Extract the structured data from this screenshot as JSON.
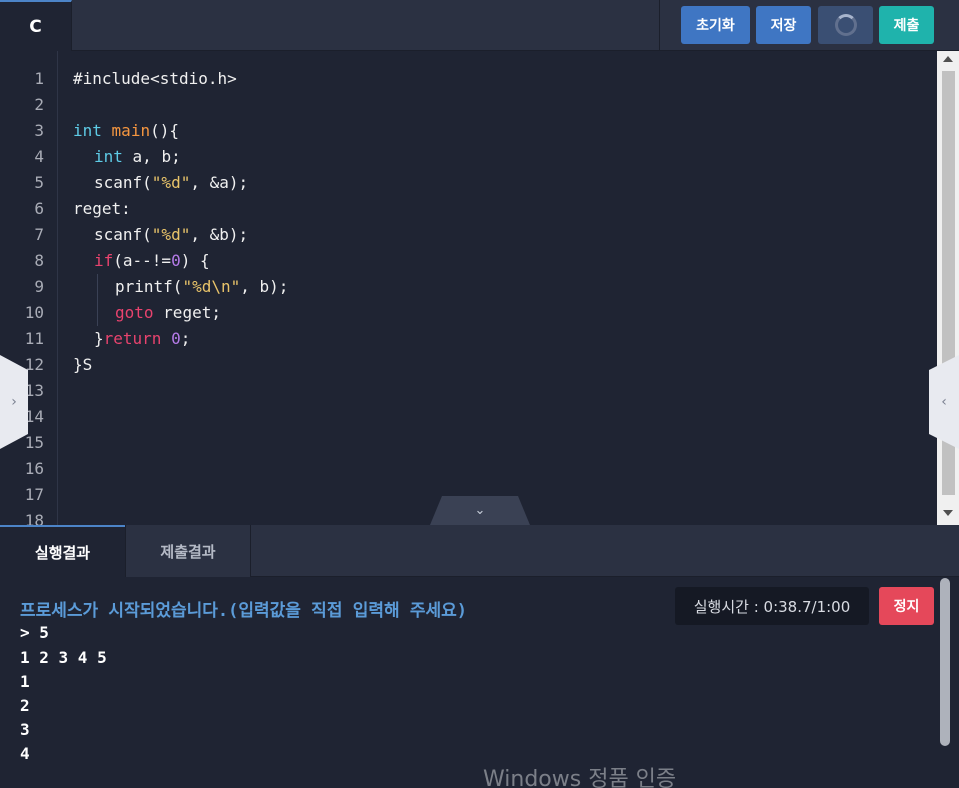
{
  "editor_header": {
    "language_tab": "C",
    "buttons": {
      "reset": "초기화",
      "save": "저장",
      "submit": "제출"
    }
  },
  "editor": {
    "line_numbers": [
      "1",
      "2",
      "3",
      "4",
      "5",
      "6",
      "7",
      "8",
      "9",
      "10",
      "11",
      "12",
      "13",
      "14",
      "15",
      "16",
      "17",
      "18"
    ],
    "code": {
      "l1": "#include<stdio.h>",
      "l3a": "int",
      "l3b": "main",
      "l3c": "(){",
      "l4a": "int",
      "l4b": "a, b;",
      "l5a": "scanf(",
      "l5b": "\"%d\"",
      "l5c": ", &a);",
      "l6": "reget:",
      "l7a": "scanf(",
      "l7b": "\"%d\"",
      "l7c": ", &b);",
      "l8a": "if",
      "l8b": "(a--!=",
      "l8c": "0",
      "l8d": ") {",
      "l9a": "printf(",
      "l9b": "\"%d\\n\"",
      "l9c": ", b);",
      "l10a": "goto",
      "l10b": "reget;",
      "l11a": "}",
      "l11b": "return",
      "l11c": "0",
      "l11d": ";",
      "l12": "}S"
    }
  },
  "result_tabs": {
    "run_result": "실행결과",
    "submit_result": "제출결과"
  },
  "console": {
    "message": "프로세스가 시작되었습니다.(입력값을 직접 입력해 주세요)",
    "lines": [
      "> 5",
      "1 2 3 4 5",
      "1",
      "2",
      "3",
      "4"
    ],
    "timer": "실행시간 : 0:38.7/1:00",
    "stop_label": "정지"
  },
  "watermark": "Windows 정품 인증",
  "colors": {
    "accent_blue": "#3f76c3",
    "submit_teal": "#1fb3ac",
    "stop_red": "#e5485a",
    "console_message": "#5b9bd8"
  },
  "icons": {
    "run": "spinner-icon",
    "collapse": "chevron-down-icon",
    "left_panel": "chevron-right-icon",
    "right_panel": "chevron-left-icon"
  }
}
